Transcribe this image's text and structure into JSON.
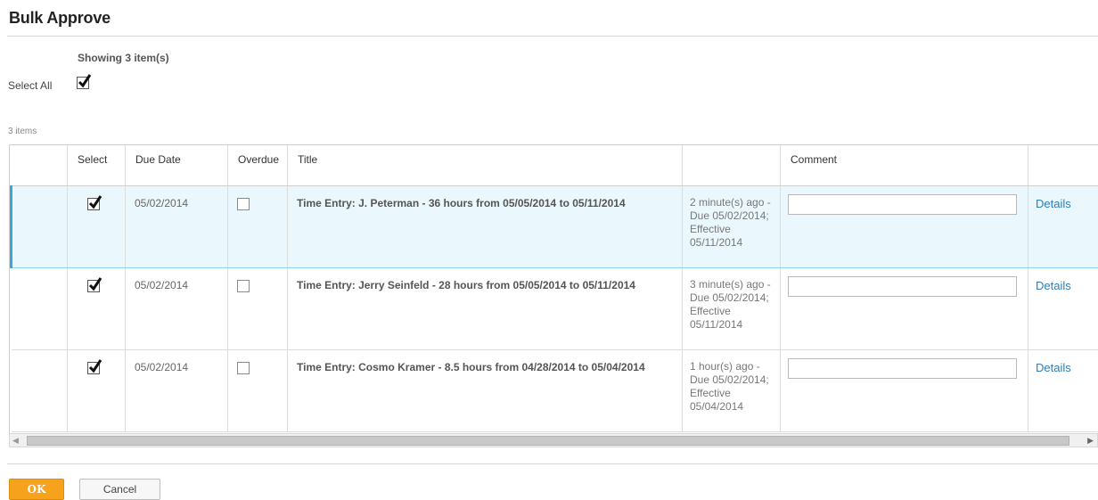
{
  "page": {
    "title": "Bulk Approve",
    "showing_text": "Showing 3 item(s)",
    "select_all_label": "Select All",
    "select_all_checked": true,
    "item_count": "3 items"
  },
  "grid": {
    "columns": [
      "",
      "Select",
      "Due Date",
      "Overdue",
      "Title",
      "",
      "Comment",
      ""
    ],
    "rows": [
      {
        "selected_row": true,
        "checked": true,
        "due_date": "05/02/2014",
        "overdue": false,
        "title": "Time Entry: J. Peterman - 36 hours from 05/05/2014 to 05/11/2014",
        "status": "2 minute(s) ago - Due 05/02/2014; Effective 05/11/2014",
        "comment": "",
        "details_label": "Details"
      },
      {
        "selected_row": false,
        "checked": true,
        "due_date": "05/02/2014",
        "overdue": false,
        "title": "Time Entry: Jerry Seinfeld - 28 hours from 05/05/2014 to 05/11/2014",
        "status": "3 minute(s) ago - Due 05/02/2014; Effective 05/11/2014",
        "comment": "",
        "details_label": "Details"
      },
      {
        "selected_row": false,
        "checked": true,
        "due_date": "05/02/2014",
        "overdue": false,
        "title": "Time Entry: Cosmo Kramer - 8.5 hours from 04/28/2014 to 05/04/2014",
        "status": "1 hour(s) ago - Due 05/02/2014; Effective 05/04/2014",
        "comment": "",
        "details_label": "Details"
      }
    ]
  },
  "scrollbar": {
    "left_icon": "scroll-left-arrow-icon",
    "right_icon": "scroll-right-arrow-icon"
  },
  "footer": {
    "ok_label": "OK",
    "cancel_label": "Cancel"
  },
  "colors": {
    "accent_button": "#f6a21c",
    "selected_row_bg": "#eaf7fd",
    "selected_row_marker": "#39a6dc",
    "link": "#2a7fbb"
  }
}
